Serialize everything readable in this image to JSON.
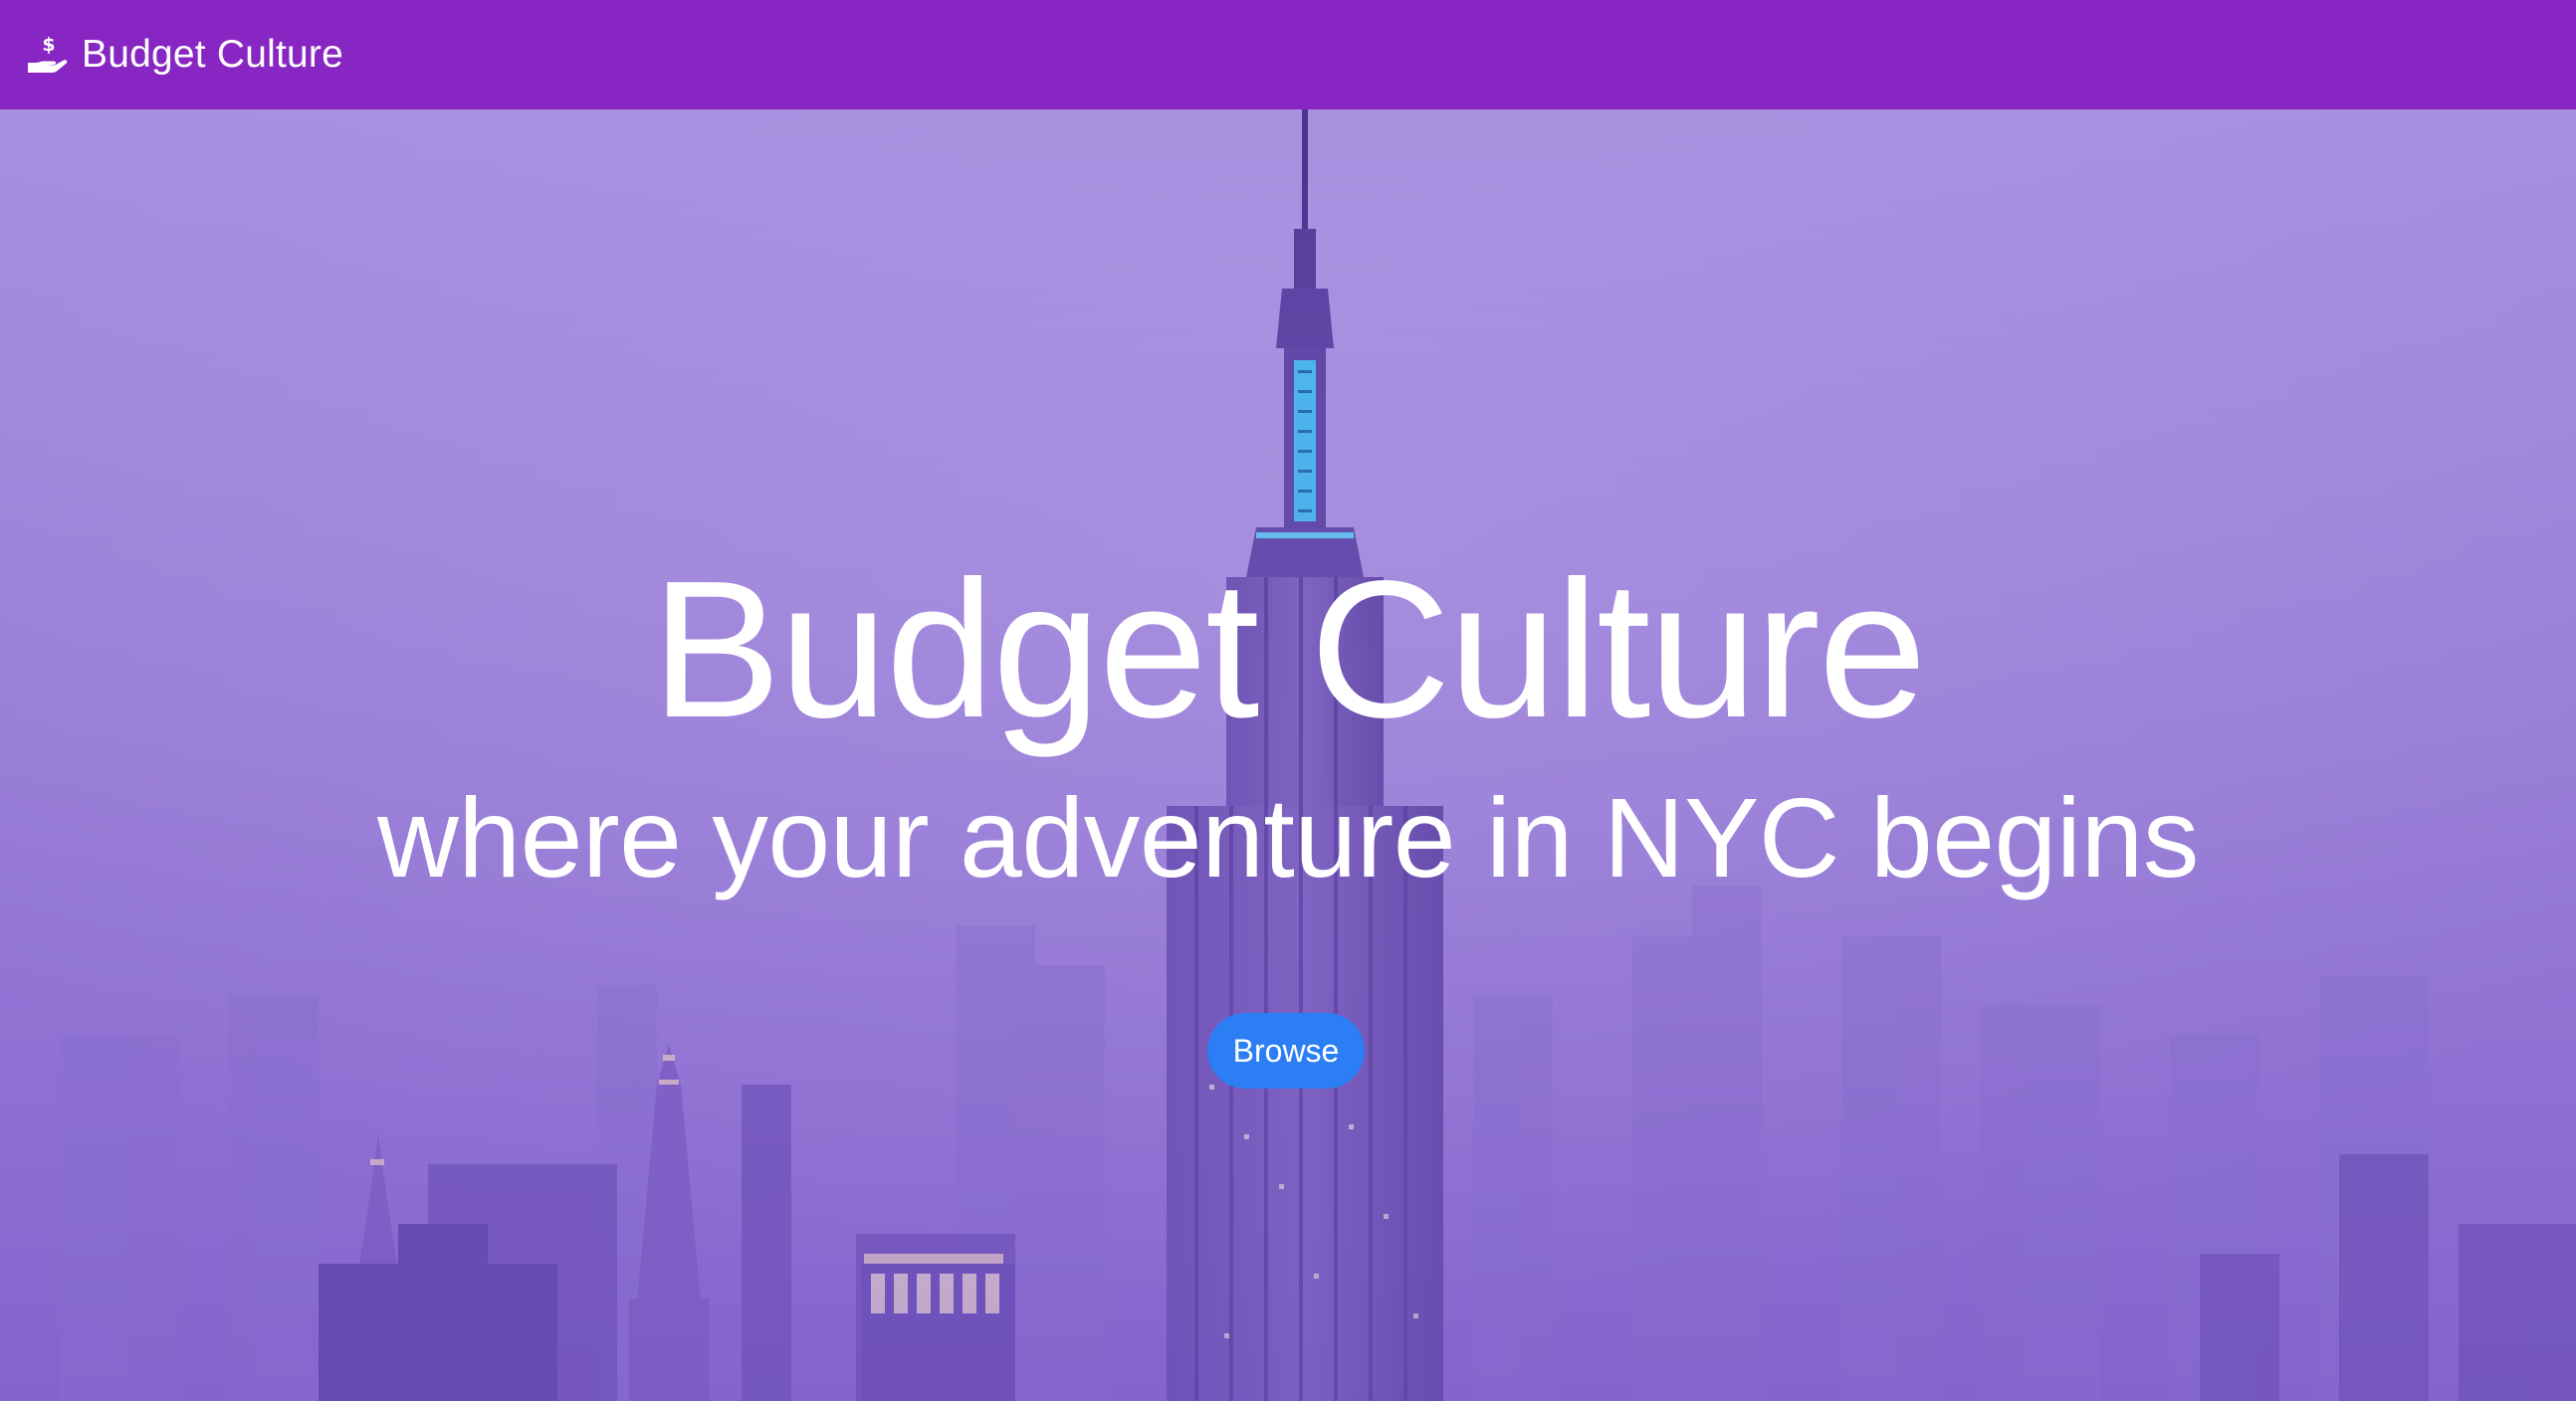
{
  "navbar": {
    "brand_label": "Budget Culture",
    "brand_icon": "hand-holding-dollar-icon",
    "background_color": "#8826c3"
  },
  "hero": {
    "title": "Budget Culture",
    "subtitle": "where your adventure in NYC begins",
    "background_image": "empire-state-building-skyline-photo",
    "overlay_color": "#9d86d9"
  },
  "browse_button": {
    "label": "Browse",
    "color": "#2c7ef4"
  }
}
